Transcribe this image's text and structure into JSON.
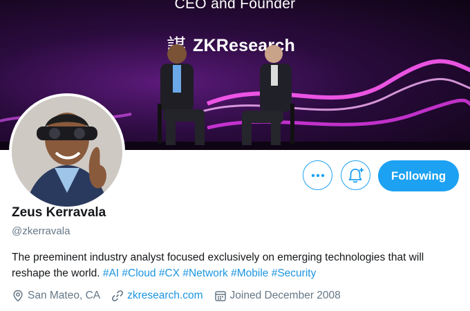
{
  "banner": {
    "title": "CEO and Founder",
    "logo_mark": "謀",
    "logo_text": "ZKResearch"
  },
  "buttons": {
    "more_icon": "more-dots-icon",
    "bell_icon": "notification-bell-plus-icon",
    "follow_label": "Following"
  },
  "profile": {
    "name": "Zeus Kerravala",
    "handle": "@zkerravala",
    "bio_text": "The preeminent industry analyst focused exclusively on emerging technologies that will reshape the world.",
    "hashtags": [
      "#AI",
      "#Cloud",
      "#CX",
      "#Network",
      "#Mobile",
      "#Security"
    ],
    "location": "San Mateo, CA",
    "website": "zkresearch.com",
    "joined": "Joined December 2008"
  },
  "colors": {
    "accent": "#1da1f2",
    "link": "#1b95e0",
    "secondary_text": "#657786"
  }
}
